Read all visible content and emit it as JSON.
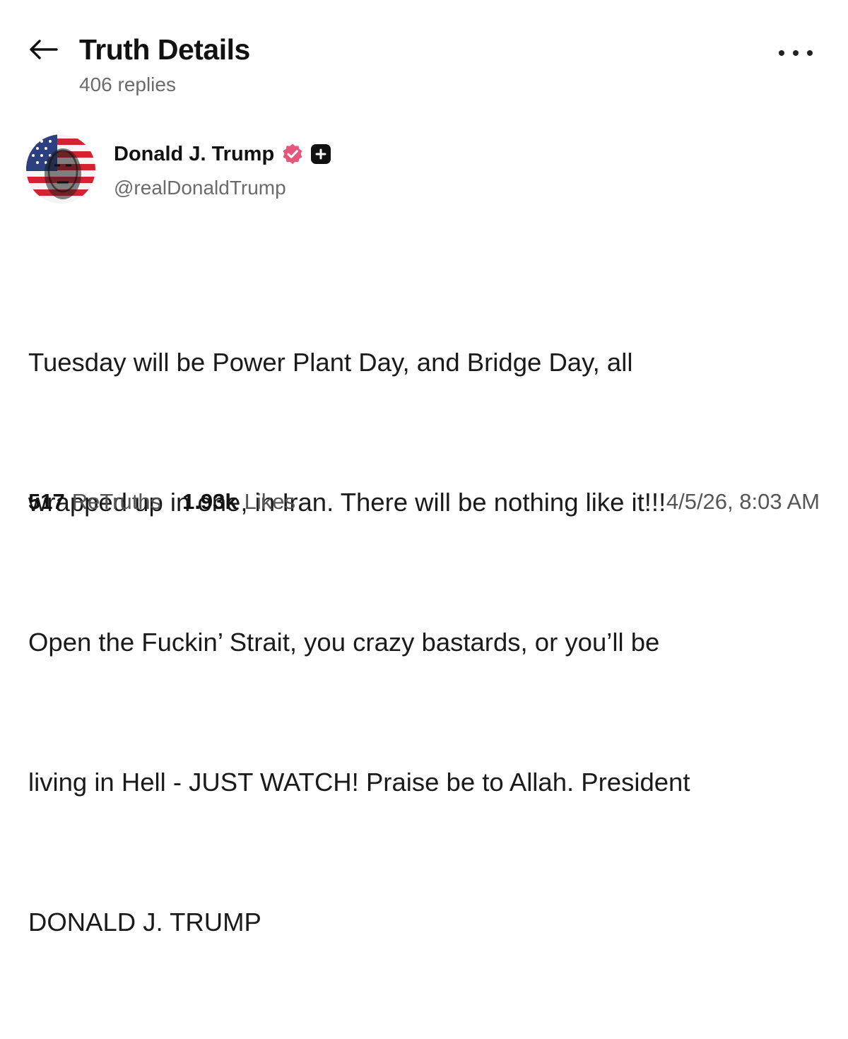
{
  "header": {
    "title": "Truth Details",
    "replies": "406 replies"
  },
  "author": {
    "name": "Donald J. Trump",
    "handle": "@realDonaldTrump",
    "verified": true
  },
  "post": {
    "lines": [
      "Tuesday will be Power Plant Day, and Bridge Day, all",
      "wrapped up in one, in Iran. There will be nothing like it!!!",
      "Open the Fuckin’ Strait, you crazy bastards, or you’ll be",
      "living in Hell - JUST WATCH! Praise be to Allah. President",
      "DONALD J. TRUMP"
    ]
  },
  "stats": {
    "retruths_count": "517",
    "retruths_label": "ReTruths",
    "likes_count": "1.93k",
    "likes_label": "Likes"
  },
  "timestamp": "4/5/26, 8:03 AM",
  "icons": {
    "back": "arrow-left-icon",
    "more": "more-horizontal-icon",
    "verified": "verified-badge-icon",
    "plus": "plus-badge-icon"
  },
  "colors": {
    "verified_badge": "#e4577a",
    "muted_text": "#6b6b6b",
    "primary_text": "#111111"
  }
}
